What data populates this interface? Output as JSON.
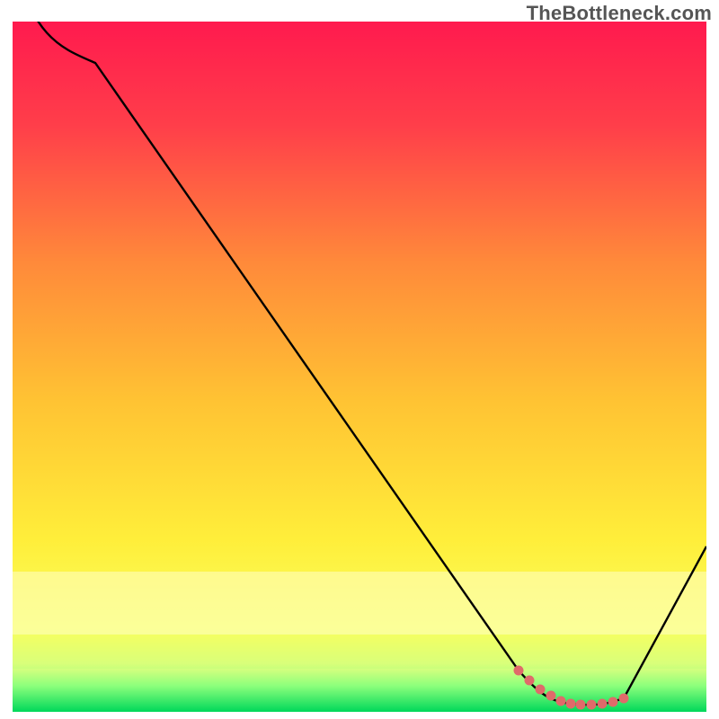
{
  "attribution": "TheBottleneck.com",
  "chart_data": {
    "type": "line",
    "title": "",
    "xlabel": "",
    "ylabel": "",
    "xlim": [
      0,
      100
    ],
    "ylim": [
      0,
      100
    ],
    "series": [
      {
        "name": "bottleneck-curve",
        "x": [
          0,
          6,
          12,
          73,
          78,
          82,
          85,
          88,
          100
        ],
        "values": [
          110,
          100,
          94,
          6,
          2,
          1,
          1,
          2,
          24
        ]
      },
      {
        "name": "optimal-range-markers",
        "x": [
          73,
          74.5,
          76,
          77.5,
          79,
          80.5,
          82,
          83.5,
          85,
          86.5,
          88
        ],
        "values": [
          6,
          4.5,
          3.3,
          2.3,
          1.6,
          1.2,
          1,
          1,
          1.1,
          1.4,
          2
        ]
      }
    ],
    "background": {
      "type": "vertical-gradient",
      "stops": [
        {
          "pos": 0.0,
          "color": "#ff1a4e"
        },
        {
          "pos": 0.15,
          "color": "#ff3e4a"
        },
        {
          "pos": 0.35,
          "color": "#ff8a3a"
        },
        {
          "pos": 0.55,
          "color": "#ffc333"
        },
        {
          "pos": 0.75,
          "color": "#ffee3a"
        },
        {
          "pos": 0.88,
          "color": "#f8ff5e"
        },
        {
          "pos": 0.93,
          "color": "#d9ff7a"
        },
        {
          "pos": 0.97,
          "color": "#7fff7f"
        },
        {
          "pos": 1.0,
          "color": "#00e45a"
        }
      ]
    },
    "curve_color": "#000000",
    "marker_color": "#e06a6a"
  }
}
